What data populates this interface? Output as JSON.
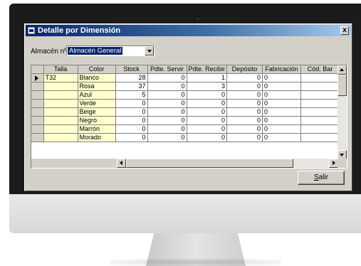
{
  "window": {
    "title": "Detalle por Dimensión",
    "close_label": "x"
  },
  "filters": {
    "almacen_label": "Almacén nº",
    "almacen_value": "Almacén General"
  },
  "grid": {
    "headers": [
      "Talla",
      "Color",
      "Stock",
      "Pdte. Servir",
      "Pdte. Recibir",
      "Depósito",
      "Fabricación",
      "Cód. Bar"
    ],
    "rows": [
      {
        "talla": "T32",
        "color": "Blanco",
        "stock": "28",
        "pdte_servir": "0",
        "pdte_recibir": "1",
        "deposito": "0",
        "fabricacion": "0",
        "cod_bar": ""
      },
      {
        "talla": "",
        "color": "Rosa",
        "stock": "37",
        "pdte_servir": "0",
        "pdte_recibir": "3",
        "deposito": "0",
        "fabricacion": "0",
        "cod_bar": ""
      },
      {
        "talla": "",
        "color": "Azul",
        "stock": "5",
        "pdte_servir": "0",
        "pdte_recibir": "0",
        "deposito": "0",
        "fabricacion": "0",
        "cod_bar": ""
      },
      {
        "talla": "",
        "color": "Verde",
        "stock": "0",
        "pdte_servir": "0",
        "pdte_recibir": "0",
        "deposito": "0",
        "fabricacion": "0",
        "cod_bar": ""
      },
      {
        "talla": "",
        "color": "Beige",
        "stock": "0",
        "pdte_servir": "0",
        "pdte_recibir": "0",
        "deposito": "0",
        "fabricacion": "0",
        "cod_bar": ""
      },
      {
        "talla": "",
        "color": "Negro",
        "stock": "0",
        "pdte_servir": "0",
        "pdte_recibir": "0",
        "deposito": "0",
        "fabricacion": "0",
        "cod_bar": ""
      },
      {
        "talla": "",
        "color": "Marrón",
        "stock": "0",
        "pdte_servir": "0",
        "pdte_recibir": "0",
        "deposito": "0",
        "fabricacion": "0",
        "cod_bar": ""
      },
      {
        "talla": "",
        "color": "Morado",
        "stock": "0",
        "pdte_servir": "0",
        "pdte_recibir": "0",
        "deposito": "0",
        "fabricacion": "0",
        "cod_bar": ""
      }
    ]
  },
  "buttons": {
    "salir_first": "S",
    "salir_rest": "alir"
  },
  "colors": {
    "title_bar": "#0a246a",
    "window_face": "#d4d0c8",
    "fixed_column": "#ffffcc",
    "monitor_bezel": "#1b1b1b"
  }
}
